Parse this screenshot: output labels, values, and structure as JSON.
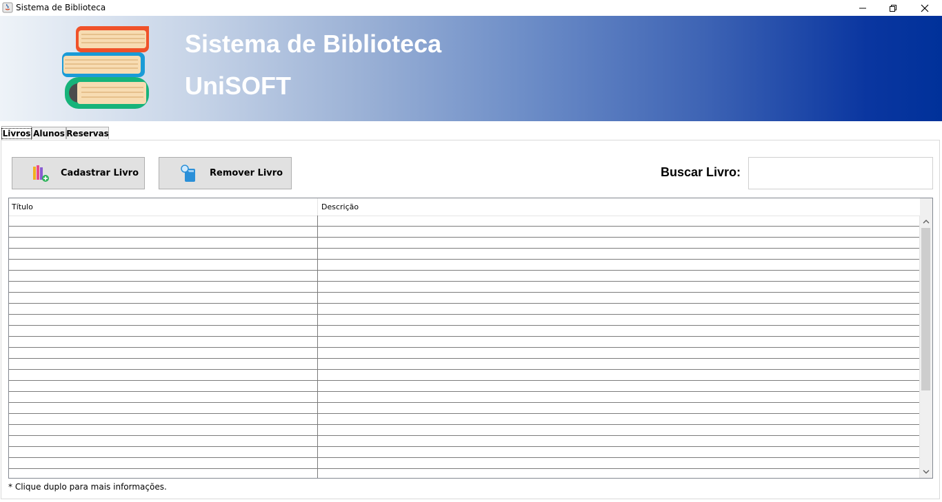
{
  "window": {
    "title": "Sistema de Biblioteca",
    "controls": [
      "minimize-icon",
      "restore-icon",
      "close-icon"
    ]
  },
  "banner": {
    "line1": "Sistema de Biblioteca",
    "line2": "UniSOFT",
    "logo_icon": "books-stack-icon"
  },
  "tabs": [
    {
      "label": "Livros",
      "active": true
    },
    {
      "label": "Alunos",
      "active": false
    },
    {
      "label": "Reservas",
      "active": false
    }
  ],
  "toolbar": {
    "add_label": "Cadastrar Livro",
    "add_icon": "books-add-icon",
    "remove_label": "Remover Livro",
    "remove_icon": "book-search-icon",
    "search_label": "Buscar Livro:",
    "search_value": ""
  },
  "table": {
    "columns": [
      "Título",
      "Descrição"
    ],
    "rows": []
  },
  "hint": "* Clique duplo para mais informações.",
  "colors": {
    "banner_start": "#eef3f8",
    "banner_end": "#00319a",
    "button_bg": "#e1e1e1"
  }
}
